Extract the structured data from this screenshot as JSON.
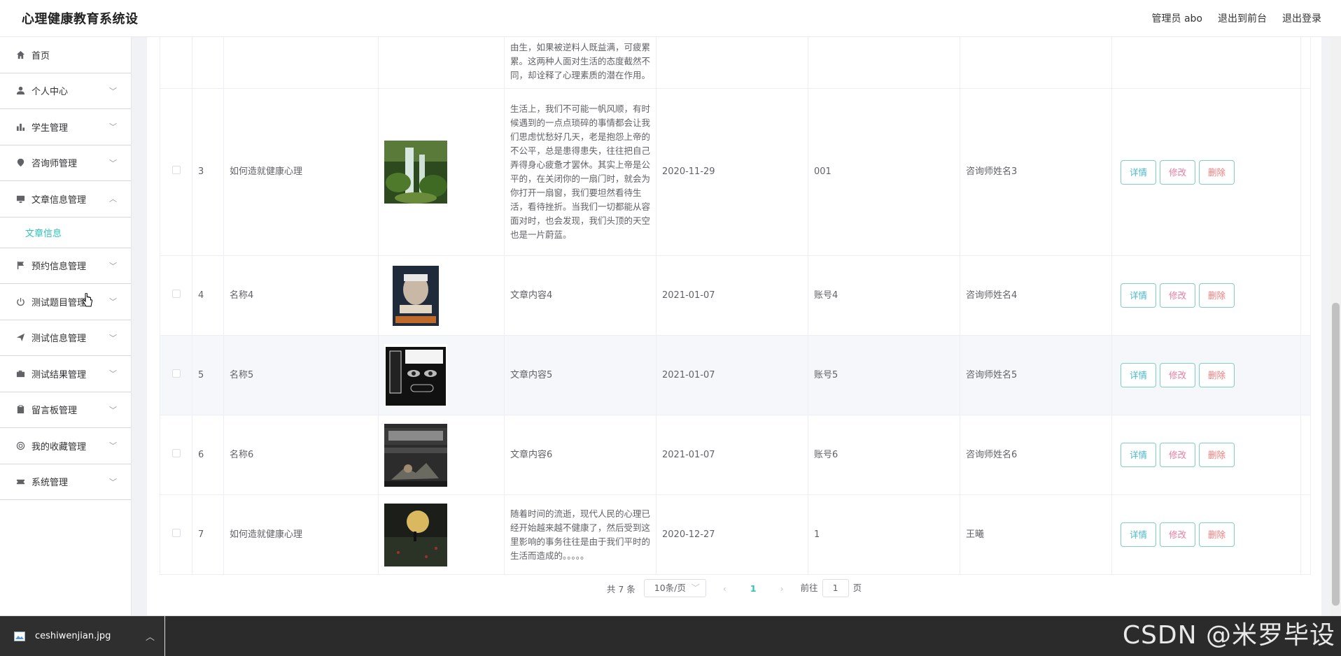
{
  "header": {
    "title": "心理健康教育系统设",
    "user_label": "管理员 abo",
    "front_label": "退出到前台",
    "logout_label": "退出登录"
  },
  "sidebar": {
    "items": [
      {
        "label": "首页",
        "icon": "home-icon"
      },
      {
        "label": "个人中心",
        "icon": "user-icon"
      },
      {
        "label": "学生管理",
        "icon": "bar-chart-icon"
      },
      {
        "label": "咨询师管理",
        "icon": "location-icon"
      },
      {
        "label": "文章信息管理",
        "icon": "monitor-icon"
      },
      {
        "label": "预约信息管理",
        "icon": "flag-icon"
      },
      {
        "label": "测试题目管理",
        "icon": "power-icon"
      },
      {
        "label": "测试信息管理",
        "icon": "send-icon"
      },
      {
        "label": "测试结果管理",
        "icon": "camera-icon"
      },
      {
        "label": "留言板管理",
        "icon": "clipboard-icon"
      },
      {
        "label": "我的收藏管理",
        "icon": "target-icon"
      },
      {
        "label": "系统管理",
        "icon": "ticket-icon"
      }
    ],
    "submenu_label": "文章信息"
  },
  "table": {
    "partial_row": {
      "content": "由生，如果被逆料人既益满，可疲累累。这两种人面对生活的态度截然不同，却诠释了心理素质的潜在作用。"
    },
    "rows": [
      {
        "id": "3",
        "name": "如何造就健康心理",
        "content": "生活上，我们不可能一帆风顺，有时候遇到的一点点琐碎的事情都会让我们思虑忧愁好几天，老是抱怨上帝的不公平，总是患得患失，往往把自己弄得身心疲惫才罢休。其实上帝是公平的，在关闭你的一扇门时，就会为你打开一扇窗，我们要坦然看待生活，看待挫折。当我们一切都能从容面对时，也会发现，我们头顶的天空也是一片蔚蓝。",
        "date": "2020-11-29",
        "account": "001",
        "counselor": "咨询师姓名3",
        "image": "forest"
      },
      {
        "id": "4",
        "name": "名称4",
        "content": "文章内容4",
        "date": "2021-01-07",
        "account": "账号4",
        "counselor": "咨询师姓名4",
        "image": "book-portrait"
      },
      {
        "id": "5",
        "name": "名称5",
        "content": "文章内容5",
        "date": "2021-01-07",
        "account": "账号5",
        "counselor": "咨询师姓名5",
        "image": "book-eyes"
      },
      {
        "id": "6",
        "name": "名称6",
        "content": "文章内容6",
        "date": "2021-01-07",
        "account": "账号6",
        "counselor": "咨询师姓名6",
        "image": "book-fitness"
      },
      {
        "id": "7",
        "name": "如何造就健康心理",
        "content": "随着时间的流逝，现代人民的心理已经开始越来越不健康了，然后受到这里影响的事务往往是由于我们平时的生活而造成的。。。。。",
        "date": "2020-12-27",
        "account": "1",
        "counselor": "王曦",
        "image": "moon-field"
      }
    ],
    "buttons": {
      "detail": "详情",
      "edit": "修改",
      "delete": "删除"
    }
  },
  "pagination": {
    "total": "共 7 条",
    "page_size": "10条/页",
    "current_page": "1",
    "goto_prefix": "前往",
    "goto_value": "1",
    "goto_suffix": "页"
  },
  "download_bar": {
    "filename": "ceshiwenjian.jpg"
  },
  "watermark": "CSDN @米罗毕设",
  "colors": {
    "accent": "#2ec4b6",
    "detail": "#4ab8c8",
    "edit": "#e87ca0",
    "delete": "#f07a7a"
  }
}
